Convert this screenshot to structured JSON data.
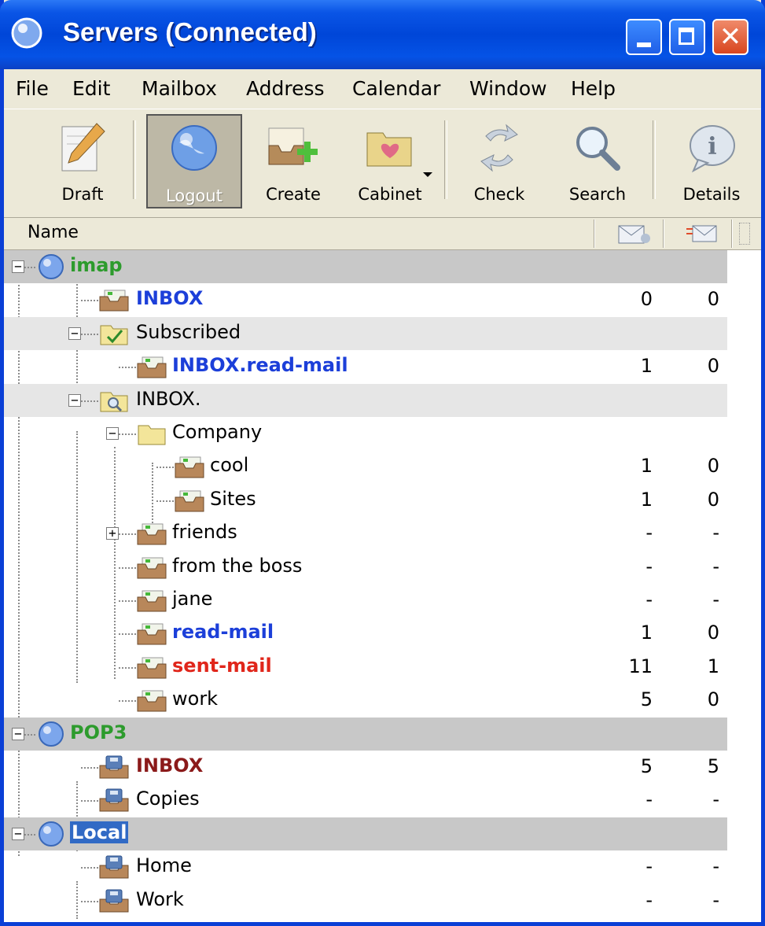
{
  "window": {
    "title": "Servers (Connected)"
  },
  "menu": [
    "File",
    "Edit",
    "Mailbox",
    "Address",
    "Calendar",
    "Window",
    "Help"
  ],
  "toolbar": {
    "draft": "Draft",
    "logout": "Logout",
    "create": "Create",
    "cabinet": "Cabinet",
    "check": "Check",
    "search": "Search",
    "details": "Details"
  },
  "columns": {
    "name": "Name",
    "unread_icon": "envelope-icon",
    "new_icon": "flag-envelope-icon"
  },
  "tree": [
    {
      "label": "imap",
      "unread": "",
      "new": "",
      "color": "#2d9b2d",
      "bold": true,
      "type": "server"
    },
    {
      "label": "INBOX",
      "unread": "0",
      "new": "0",
      "color": "#1c3fd9",
      "bold": true,
      "type": "mailbox"
    },
    {
      "label": "Subscribed",
      "unread": "",
      "new": "",
      "color": "#000000",
      "bold": false,
      "type": "subscribed"
    },
    {
      "label": "INBOX.read-mail",
      "unread": "1",
      "new": "0",
      "color": "#1c3fd9",
      "bold": true,
      "type": "mailbox"
    },
    {
      "label": "INBOX.",
      "unread": "",
      "new": "",
      "color": "#000000",
      "bold": false,
      "type": "search-folder"
    },
    {
      "label": "Company",
      "unread": "",
      "new": "",
      "color": "#000000",
      "bold": false,
      "type": "folder"
    },
    {
      "label": "cool",
      "unread": "1",
      "new": "0",
      "color": "#000000",
      "bold": false,
      "type": "mailbox"
    },
    {
      "label": "Sites",
      "unread": "1",
      "new": "0",
      "color": "#000000",
      "bold": false,
      "type": "mailbox"
    },
    {
      "label": "friends",
      "unread": "-",
      "new": "-",
      "color": "#000000",
      "bold": false,
      "type": "mailbox"
    },
    {
      "label": "from the boss",
      "unread": "-",
      "new": "-",
      "color": "#000000",
      "bold": false,
      "type": "mailbox"
    },
    {
      "label": "jane",
      "unread": "-",
      "new": "-",
      "color": "#000000",
      "bold": false,
      "type": "mailbox"
    },
    {
      "label": "read-mail",
      "unread": "1",
      "new": "0",
      "color": "#1c3fd9",
      "bold": true,
      "type": "mailbox"
    },
    {
      "label": "sent-mail",
      "unread": "11",
      "new": "1",
      "color": "#e0261b",
      "bold": true,
      "type": "mailbox"
    },
    {
      "label": "work",
      "unread": "5",
      "new": "0",
      "color": "#000000",
      "bold": false,
      "type": "mailbox"
    },
    {
      "label": "POP3",
      "unread": "",
      "new": "",
      "color": "#2d9b2d",
      "bold": true,
      "type": "server"
    },
    {
      "label": "INBOX",
      "unread": "5",
      "new": "5",
      "color": "#8b1a1a",
      "bold": true,
      "type": "local-mailbox"
    },
    {
      "label": "Copies",
      "unread": "-",
      "new": "-",
      "color": "#000000",
      "bold": false,
      "type": "local-mailbox"
    },
    {
      "label": "Local",
      "unread": "",
      "new": "",
      "color": "#ffffff",
      "bold": true,
      "type": "server",
      "selected": true
    },
    {
      "label": "Home",
      "unread": "-",
      "new": "-",
      "color": "#000000",
      "bold": false,
      "type": "local-mailbox"
    },
    {
      "label": "Work",
      "unread": "-",
      "new": "-",
      "color": "#000000",
      "bold": false,
      "type": "local-mailbox"
    }
  ]
}
